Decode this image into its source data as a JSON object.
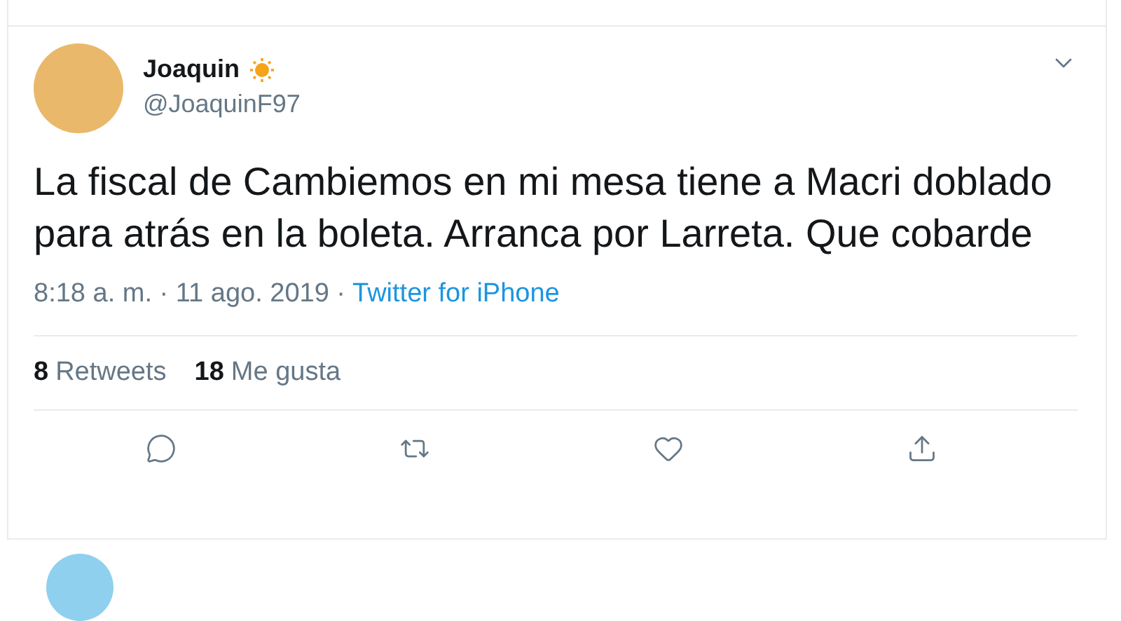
{
  "tweet": {
    "author": {
      "name": "Joaquin",
      "handle": "@JoaquinF97"
    },
    "text": "La fiscal de Cambiemos en mi mesa tiene a Macri doblado para atrás en la boleta. Arranca por Larreta. Que cobarde",
    "timestamp": "8:18 a. m. · 11 ago. 2019 ·",
    "source": "Twitter for iPhone",
    "stats": [
      {
        "count": "8",
        "label": "Retweets"
      },
      {
        "count": "18",
        "label": "Me gusta"
      }
    ],
    "actions": [
      {
        "kind": "reply"
      },
      {
        "kind": "retweet"
      },
      {
        "kind": "like"
      },
      {
        "kind": "share"
      }
    ]
  }
}
